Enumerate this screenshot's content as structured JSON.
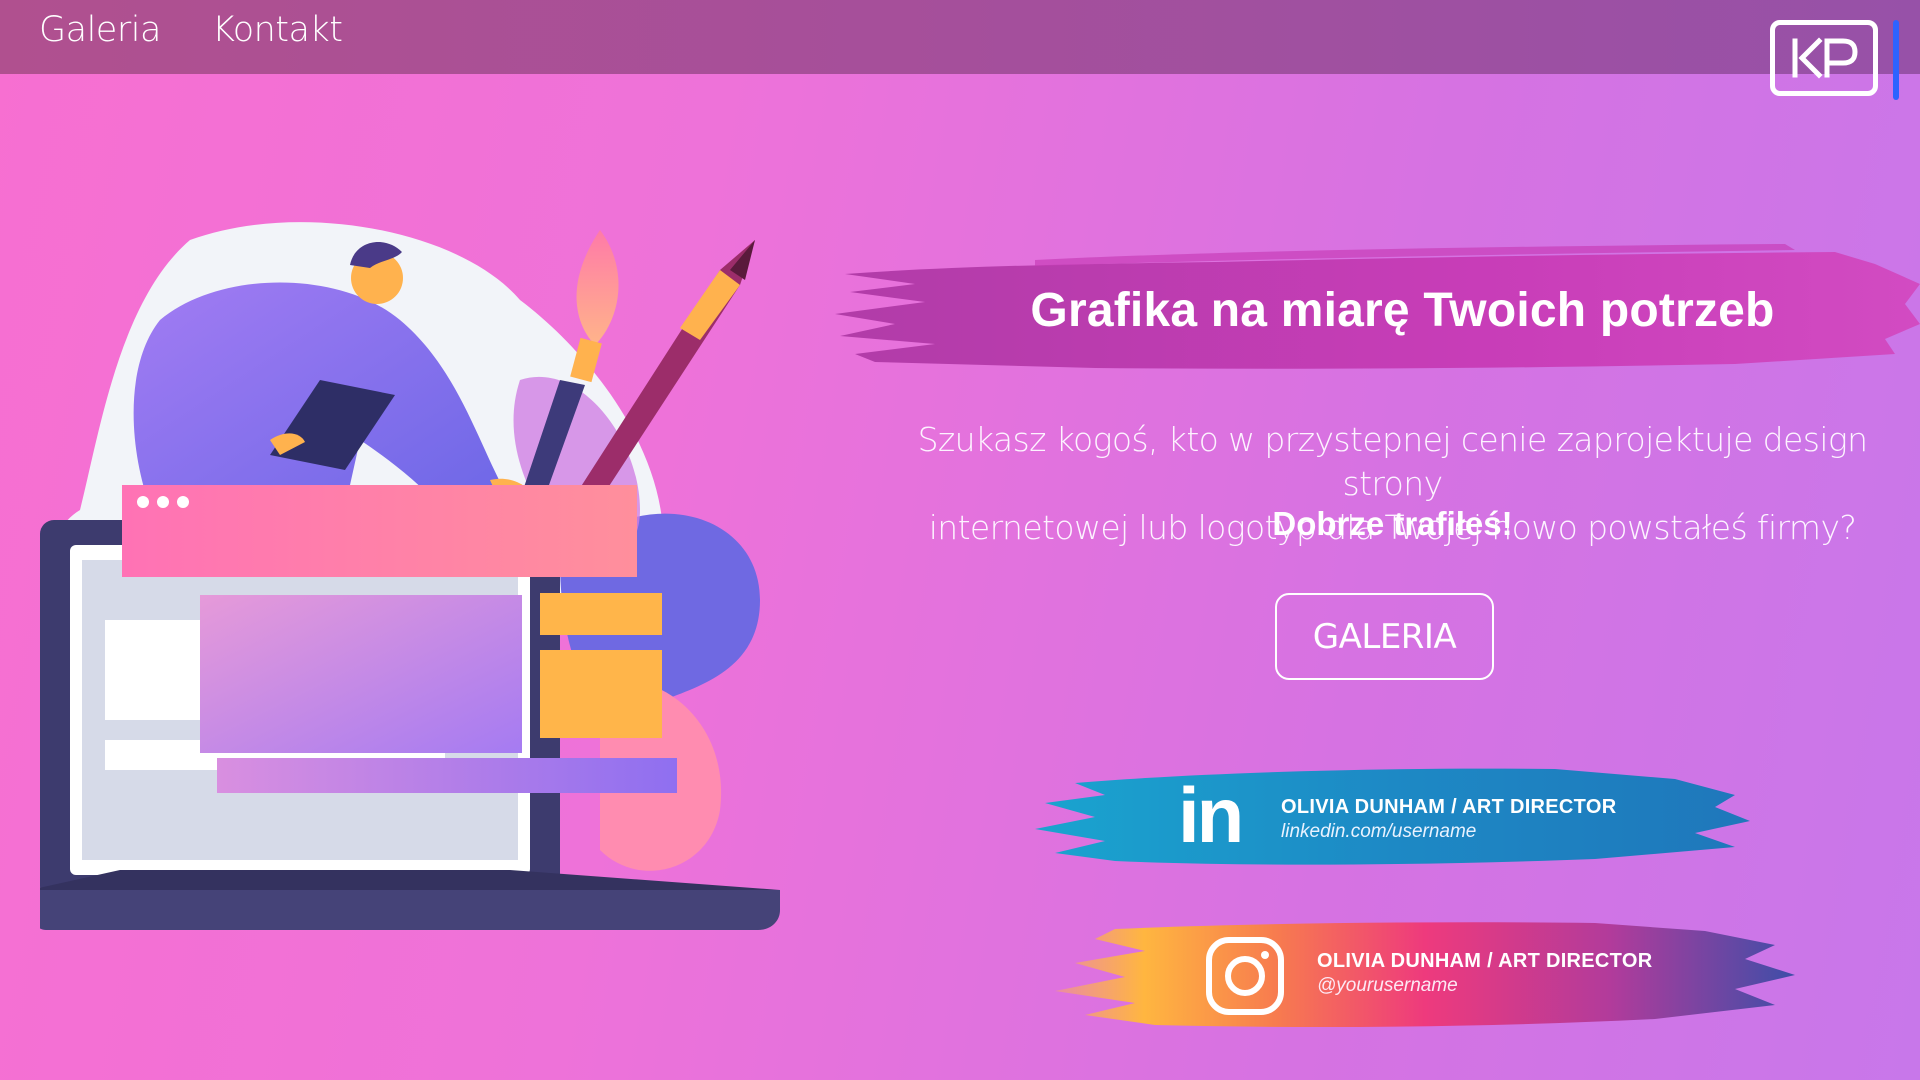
{
  "nav": {
    "items": [
      {
        "label": "Galeria"
      },
      {
        "label": "Kontakt"
      }
    ],
    "logo_text": "KP"
  },
  "hero": {
    "title": "Grafika na miarę Twoich potrzeb",
    "description_line1": "Szukasz kogoś, kto w przystepnej cenie zaprojektuje design strony",
    "description_line2": "internetowej lub logotyp dla Twojej nowo powstałeś firmy?",
    "description_strong": "Dobrze trafiłeś!",
    "cta_label": "GALERIA"
  },
  "social": {
    "linkedin": {
      "icon": "linkedin-icon",
      "icon_text": "in",
      "name": "OLIVIA DUNHAM / ART DIRECTOR",
      "handle": "linkedin.com/username"
    },
    "instagram": {
      "icon": "instagram-icon",
      "name": "OLIVIA DUNHAM / ART DIRECTOR",
      "handle": "@yourusername"
    }
  },
  "colors": {
    "background_start": "#f76fd1",
    "background_end": "#c877ea",
    "topbar": "#a54f9b",
    "title_brush": "#c43cb4",
    "linkedin_brush": "#1e8ec8",
    "logo_accent": "#2e63ff"
  }
}
